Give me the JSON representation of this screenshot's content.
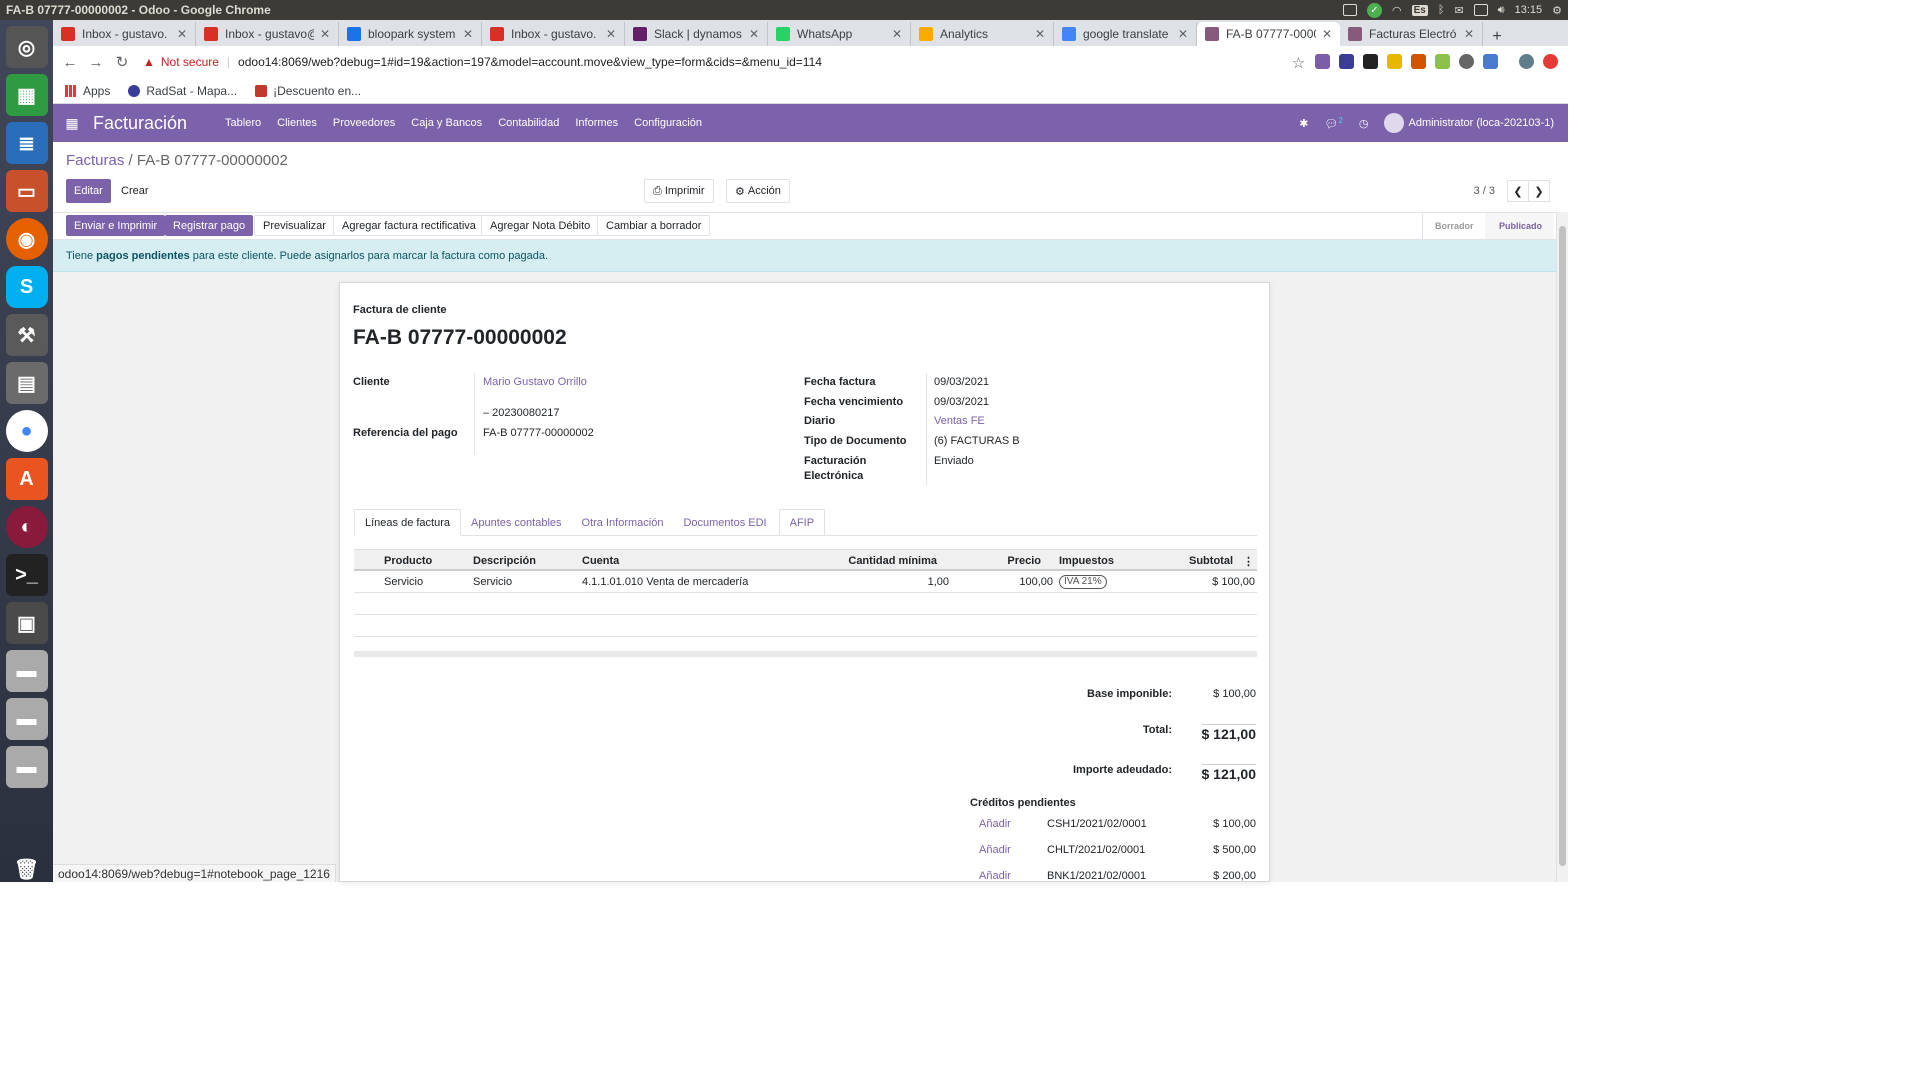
{
  "os": {
    "window_title": "FA-B 07777-00000002 - Odoo - Google Chrome",
    "clock": "13:15",
    "lang": "Es"
  },
  "browser": {
    "tabs": [
      {
        "title": "Inbox - gustavo.",
        "icon_color": "#d93025",
        "icon": "gmail-icon"
      },
      {
        "title": "Inbox - gustavo@",
        "icon_color": "#d93025",
        "icon": "gmail-icon"
      },
      {
        "title": "bloopark system",
        "icon_color": "#1a73e8",
        "icon": "bloopark-icon"
      },
      {
        "title": "Inbox - gustavo.",
        "icon_color": "#d93025",
        "icon": "gmail-icon"
      },
      {
        "title": "Slack | dynamos",
        "icon_color": "#611f69",
        "icon": "slack-icon"
      },
      {
        "title": "WhatsApp",
        "icon_color": "#25d366",
        "icon": "whatsapp-icon"
      },
      {
        "title": "Analytics",
        "icon_color": "#f9ab00",
        "icon": "analytics-icon"
      },
      {
        "title": "google translate",
        "icon_color": "#4285f4",
        "icon": "google-icon"
      },
      {
        "title": "FA-B 07777-0000",
        "icon_color": "#875a7b",
        "icon": "odoo-icon",
        "active": true
      },
      {
        "title": "Facturas Electró",
        "icon_color": "#875a7b",
        "icon": "odoo-icon"
      }
    ],
    "security": "Not secure",
    "url": "odoo14:8069/web?debug=1#id=19&action=197&model=account.move&view_type=form&cids=&menu_id=114",
    "bookmarks": [
      "Apps",
      "RadSat - Mapa...",
      "¡Descuento en..."
    ],
    "status_url": "odoo14:8069/web?debug=1#notebook_page_1216"
  },
  "odoo": {
    "app": "Facturación",
    "menus": [
      "Tablero",
      "Clientes",
      "Proveedores",
      "Caja y Bancos",
      "Contabilidad",
      "Informes",
      "Configuración"
    ],
    "chat_count": "2",
    "user": "Administrator (loca-202103-1)"
  },
  "control": {
    "breadcrumb_parent": "Facturas",
    "breadcrumb_sep": "/",
    "breadcrumb_current": "FA-B 07777-00000002",
    "edit": "Editar",
    "create": "Crear",
    "print": "Imprimir",
    "action": "Acción",
    "pager": "3 / 3"
  },
  "header_buttons": {
    "send_print": "Enviar e Imprimir",
    "register_payment": "Registrar pago",
    "preview": "Previsualizar",
    "credit_note": "Agregar factura rectificativa",
    "debit_note": "Agregar Nota Débito",
    "reset_draft": "Cambiar a borrador"
  },
  "stages": {
    "draft": "Borrador",
    "posted": "Publicado"
  },
  "alert": {
    "pre": "Tiene ",
    "bold": "pagos pendientes",
    "post": " para este cliente. Puede asignarlos para marcar la factura como pagada."
  },
  "invoice": {
    "type": "Factura de cliente",
    "number": "FA-B 07777-00000002",
    "customer_label": "Cliente",
    "customer": "Mario Gustavo Orrillo",
    "customer_vat": "– 20230080217",
    "payment_ref_label": "Referencia del pago",
    "payment_ref": "FA-B 07777-00000002",
    "date_label": "Fecha factura",
    "date": "09/03/2021",
    "due_label": "Fecha vencimiento",
    "due": "09/03/2021",
    "journal_label": "Diario",
    "journal": "Ventas FE",
    "doctype_label": "Tipo de Documento",
    "doctype": "(6) FACTURAS B",
    "einv_label_1": "Facturación",
    "einv_label_2": "Electrónica",
    "einv": "Enviado"
  },
  "notebook": [
    "Líneas de factura",
    "Apuntes contables",
    "Otra Información",
    "Documentos EDI",
    "AFIP"
  ],
  "lines": {
    "headers": {
      "product": "Producto",
      "desc": "Descripción",
      "account": "Cuenta",
      "qty": "Cantidad mínima",
      "price": "Precio",
      "taxes": "Impuestos",
      "subtotal": "Subtotal"
    },
    "rows": [
      {
        "product": "Servicio",
        "desc": "Servicio",
        "account": "4.1.1.01.010 Venta de mercadería",
        "qty": "1,00",
        "price": "100,00",
        "taxes": "IVA 21%",
        "subtotal": "$ 100,00"
      }
    ]
  },
  "totals": {
    "base_label": "Base imponible:",
    "base": "$ 100,00",
    "total_label": "Total:",
    "total": "$ 121,00",
    "due_label": "Importe adeudado:",
    "due": "$ 121,00"
  },
  "credits": {
    "title": "Créditos pendientes",
    "add": "Añadir",
    "items": [
      {
        "ref": "CSH1/2021/02/0001",
        "amount": "$ 100,00"
      },
      {
        "ref": "CHLT/2021/02/0001",
        "amount": "$ 500,00"
      },
      {
        "ref": "BNK1/2021/02/0001",
        "amount": "$ 200,00"
      }
    ]
  }
}
